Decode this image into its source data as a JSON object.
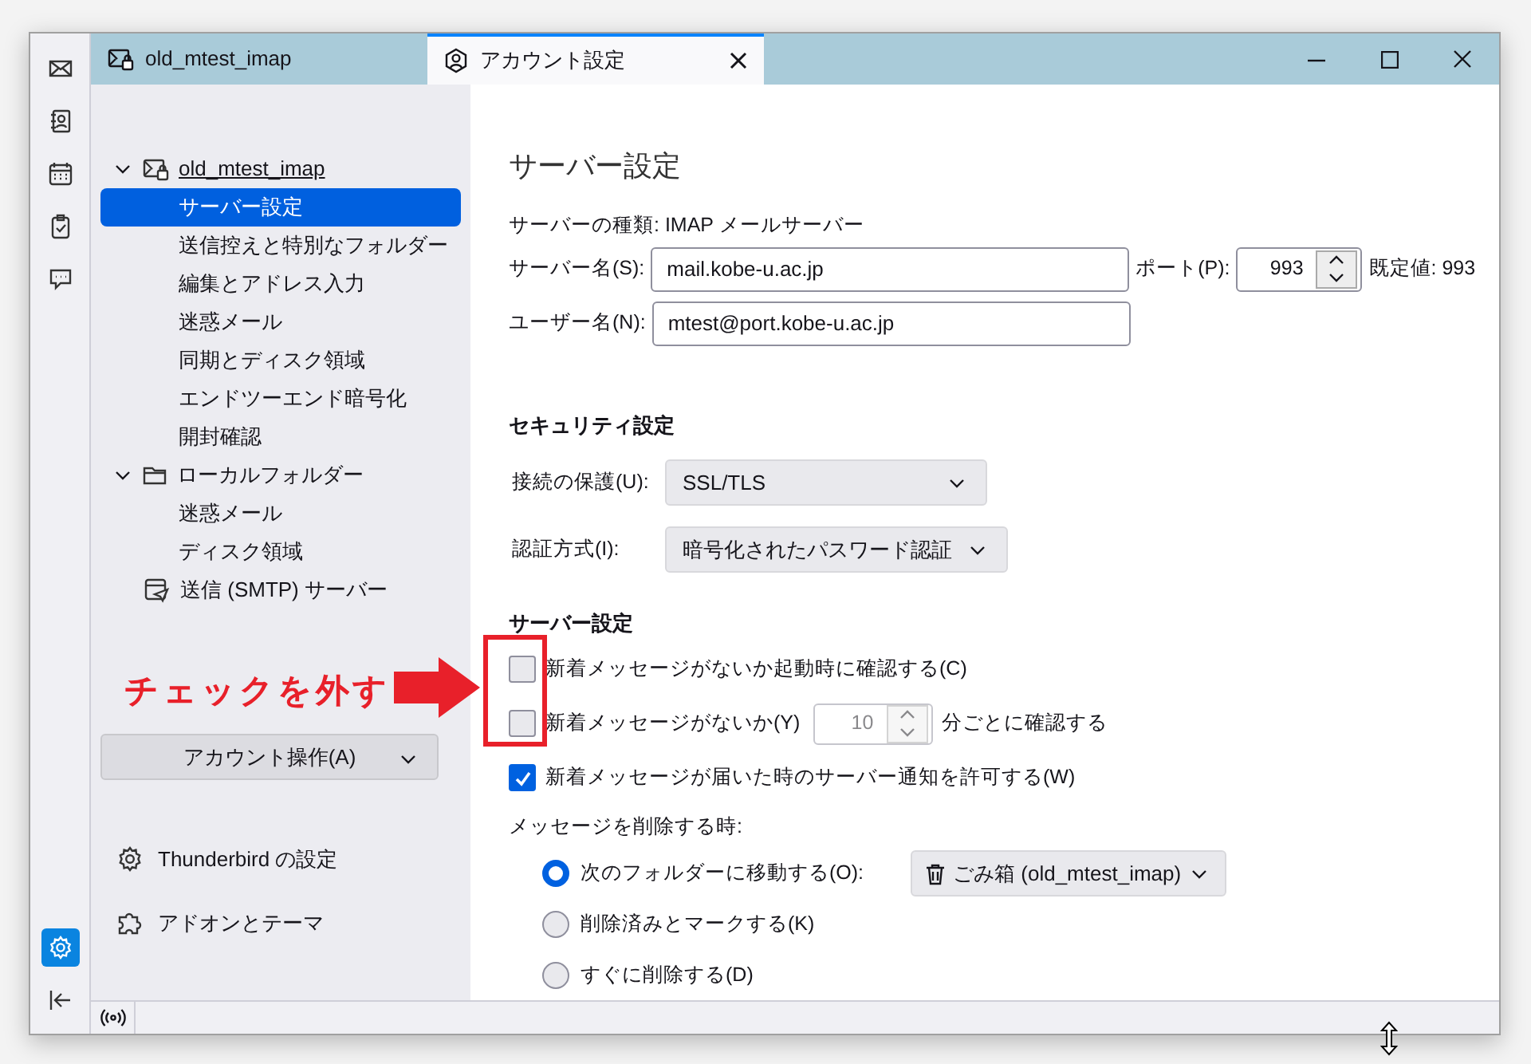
{
  "spaces": [
    {
      "kind": "mail",
      "selected": false
    },
    {
      "kind": "addressbook",
      "selected": false
    },
    {
      "kind": "calendar",
      "selected": false
    },
    {
      "kind": "tasks",
      "selected": false
    },
    {
      "kind": "chat",
      "selected": false
    }
  ],
  "spaces_bottom": [
    {
      "kind": "settings",
      "selected": true
    },
    {
      "kind": "collapse",
      "selected": false
    }
  ],
  "tabs": [
    {
      "label": "old_mtest_imap",
      "kind": "mail-account",
      "selected": false,
      "closable": false
    },
    {
      "label": "アカウント設定",
      "kind": "account",
      "selected": true,
      "closable": true
    }
  ],
  "sidebar": {
    "tree": [
      {
        "label": "old_mtest_imap",
        "kind": "mail-account",
        "expanded": true,
        "selected": false,
        "children": [
          {
            "label": "サーバー設定",
            "selected": true
          },
          {
            "label": "送信控えと特別なフォルダー",
            "selected": false
          },
          {
            "label": "編集とアドレス入力",
            "selected": false
          },
          {
            "label": "迷惑メール",
            "selected": false
          },
          {
            "label": "同期とディスク領域",
            "selected": false
          },
          {
            "label": "エンドツーエンド暗号化",
            "selected": false
          },
          {
            "label": "開封確認",
            "selected": false
          }
        ]
      },
      {
        "label": "ローカルフォルダー",
        "kind": "folder",
        "expanded": true,
        "selected": false,
        "children": [
          {
            "label": "迷惑メール",
            "selected": false
          },
          {
            "label": "ディスク領域",
            "selected": false
          }
        ]
      },
      {
        "label": "送信 (SMTP) サーバー",
        "kind": "smtp",
        "selected": false
      }
    ],
    "account_actions": {
      "label": "アカウント操作(A)"
    },
    "footer": [
      {
        "label": "Thunderbird の設定",
        "kind": "gear"
      },
      {
        "label": "アドオンとテーマ",
        "kind": "puzzle"
      }
    ]
  },
  "content": {
    "title": "サーバー設定",
    "server_type": "サーバーの種類: IMAP メールサーバー",
    "server_name": {
      "label": "サーバー名(S):",
      "value": "mail.kobe-u.ac.jp"
    },
    "port": {
      "label": "ポート(P):",
      "value": "993"
    },
    "port_default": "既定値: 993",
    "user_name": {
      "label": "ユーザー名(N):",
      "value": "mtest@port.kobe-u.ac.jp"
    },
    "security": {
      "heading": "セキュリティ設定",
      "rows": [
        {
          "label": "接続の保護(U):",
          "value": "SSL/TLS"
        },
        {
          "label": "認証方式(I):",
          "value": "暗号化されたパスワード認証"
        }
      ]
    },
    "server_settings": {
      "heading": "サーバー設定",
      "options": [
        {
          "kind": "checkbox",
          "label": "新着メッセージがないか起動時に確認する(C)",
          "checked": false
        },
        {
          "kind": "interval",
          "label": "新着メッセージがないか(Y)",
          "value": "10",
          "suffix": "分ごとに確認する",
          "checked": false
        },
        {
          "kind": "checkbox",
          "label": "新着メッセージが届いた時のサーバー通知を許可する(W)",
          "checked": true
        }
      ]
    },
    "on_delete": {
      "label": "メッセージを削除する時:",
      "options": [
        {
          "label": "次のフォルダーに移動する(O):",
          "selected": true,
          "folder": "ごみ箱 (old_mtest_imap)"
        },
        {
          "label": "削除済みとマークする(K)",
          "selected": false
        },
        {
          "label": "すぐに削除する(D)",
          "selected": false
        }
      ]
    }
  },
  "annotation": {
    "text": "チェックを外す"
  }
}
